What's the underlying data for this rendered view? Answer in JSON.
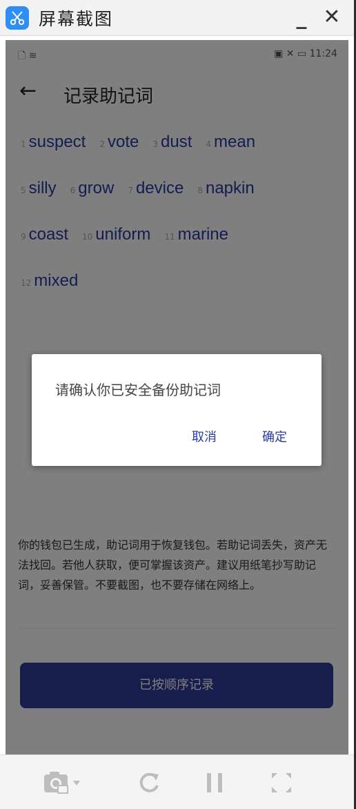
{
  "window": {
    "title": "屏幕截图",
    "minimize_label": "_",
    "close_label": "✕"
  },
  "status_bar": {
    "left_icons": "🗋 ≋",
    "right_icons": "▣ ✕ ▭",
    "time": "11:24"
  },
  "nav": {
    "back_icon": "←",
    "title": "记录助记词"
  },
  "mnemonic_rows": [
    [
      {
        "num": "1",
        "word": "suspect"
      },
      {
        "num": "2",
        "word": "vote"
      },
      {
        "num": "3",
        "word": "dust"
      },
      {
        "num": "4",
        "word": "mean"
      }
    ],
    [
      {
        "num": "5",
        "word": "silly"
      },
      {
        "num": "6",
        "word": "grow"
      },
      {
        "num": "7",
        "word": "device"
      },
      {
        "num": "8",
        "word": "napkin"
      }
    ],
    [
      {
        "num": "9",
        "word": "coast"
      },
      {
        "num": "10",
        "word": "uniform"
      },
      {
        "num": "11",
        "word": "marine"
      }
    ],
    [
      {
        "num": "12",
        "word": "mixed"
      }
    ]
  ],
  "notice": "你的钱包已生成，助记词用于恢复钱包。若助记词丢失，资产无法找回。若他人获取，便可掌握该资产。建议用纸笔抄写助记词，妥善保管。不要截图，也不要存储在网络上。",
  "confirm_button": "已按顺序记录",
  "dialog": {
    "message": "请确认你已安全备份助记词",
    "cancel": "取消",
    "ok": "确定"
  },
  "toolbar": {
    "items": [
      "camera-icon",
      "refresh-icon",
      "pause-icon",
      "fullscreen-icon"
    ]
  },
  "colors": {
    "accent": "#2f3a9a",
    "word_color": "#2a3aa0",
    "app_icon": "#2f8ef5"
  }
}
